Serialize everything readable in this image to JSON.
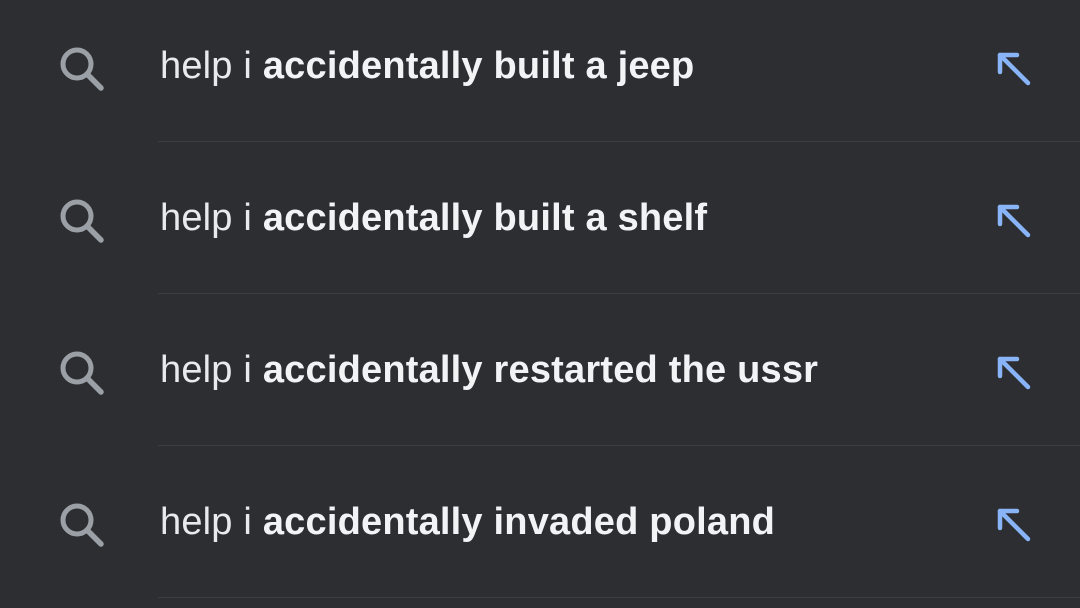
{
  "colors": {
    "background": "#2d2e31",
    "text": "#e8eaed",
    "search_icon": "#9aa0a6",
    "arrow_accent": "#8ab4f8",
    "divider": "#3c3d41"
  },
  "suggestions": [
    {
      "prefix": "help i ",
      "completion": "accidentally built a jeep",
      "icon": "search-icon",
      "action_icon": "fill-query-arrow-icon"
    },
    {
      "prefix": "help i ",
      "completion": "accidentally built a shelf",
      "icon": "search-icon",
      "action_icon": "fill-query-arrow-icon"
    },
    {
      "prefix": "help i ",
      "completion": "accidentally restarted the ussr",
      "icon": "search-icon",
      "action_icon": "fill-query-arrow-icon"
    },
    {
      "prefix": "help i ",
      "completion": "accidentally invaded poland",
      "icon": "search-icon",
      "action_icon": "fill-query-arrow-icon"
    }
  ]
}
